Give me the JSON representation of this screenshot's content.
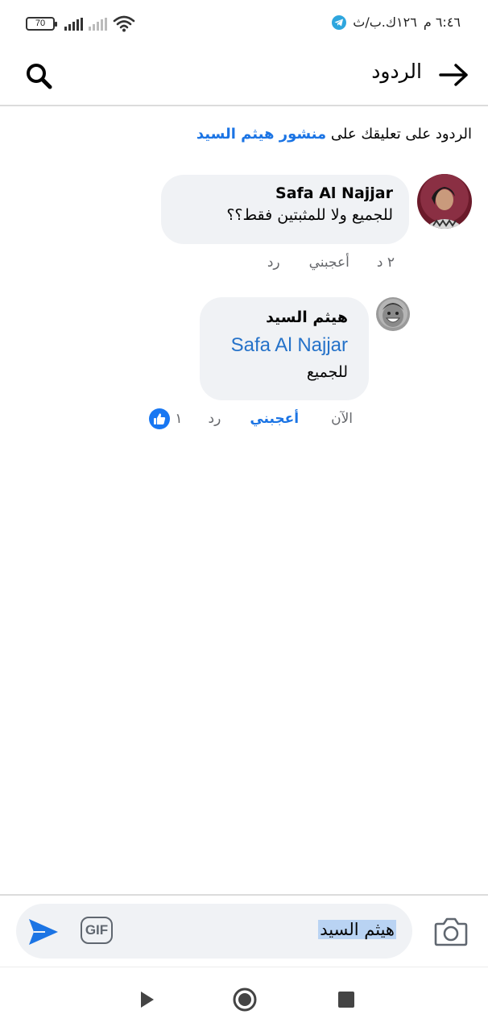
{
  "status_bar": {
    "time": "٦:٤٦ م",
    "date_text": "١٢٦ك.ب/ث",
    "battery": "70"
  },
  "header": {
    "title": "الردود"
  },
  "context": {
    "prefix": "الردود على تعليقك على",
    "link": "منشور هيثم السيد"
  },
  "comments": [
    {
      "author": "Safa Al Najjar",
      "text": "للجميع  ولا للمثبتين فقط؟؟",
      "time": "٢ د",
      "like_label": "أعجبني",
      "reply_label": "رد"
    },
    {
      "author": "هيثم السيد",
      "mention": "Safa Al Najjar",
      "text": "للجميع",
      "time": "الآن",
      "like_label": "أعجبني",
      "reply_label": "رد",
      "like_count": "١"
    }
  ],
  "composer": {
    "input_value": "هيثم السيد",
    "gif_label": "GIF",
    "icons": [
      "camera-icon",
      "gif-icon",
      "send-icon"
    ]
  },
  "navbar": {
    "icons": [
      "back-triangle-icon",
      "home-circle-icon",
      "recents-square-icon"
    ]
  },
  "colors": {
    "link": "#1b74e4",
    "bubble": "#f0f2f5",
    "mention": "#2572c9",
    "muted": "#65676b"
  }
}
